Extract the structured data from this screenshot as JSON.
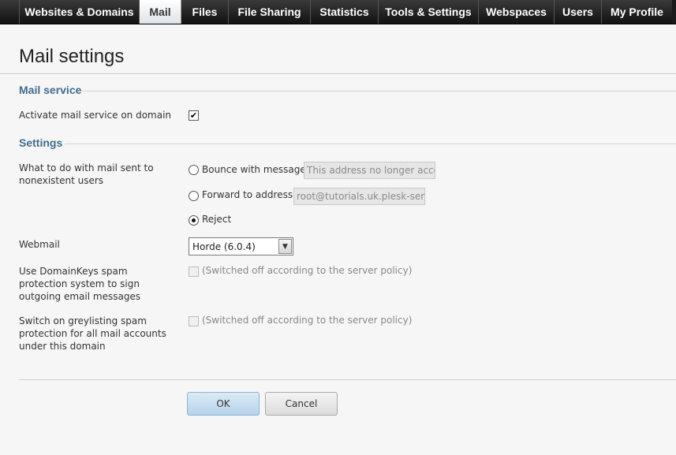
{
  "nav": {
    "tabs": [
      {
        "label": "Websites & Domains"
      },
      {
        "label": "Mail"
      },
      {
        "label": "Files"
      },
      {
        "label": "File Sharing"
      },
      {
        "label": "Statistics"
      },
      {
        "label": "Tools & Settings"
      },
      {
        "label": "Webspaces"
      },
      {
        "label": "Users"
      },
      {
        "label": "My Profile"
      }
    ],
    "active_tab": "Mail"
  },
  "page": {
    "title": "Mail settings"
  },
  "mail_service": {
    "heading": "Mail service",
    "activate_label": "Activate mail service on domain",
    "activate_checked": true
  },
  "settings": {
    "heading": "Settings",
    "nonexistent": {
      "label": "What to do with mail sent to nonexistent users",
      "options": [
        {
          "label": "Bounce with message",
          "value": "This address no longer accepts mail.",
          "selected": false
        },
        {
          "label": "Forward to address",
          "value": "root@tutorials.uk.plesk-server.com",
          "selected": false
        },
        {
          "label": "Reject",
          "selected": true
        }
      ]
    },
    "webmail": {
      "label": "Webmail",
      "selected": "Horde (6.0.4)"
    },
    "domainkeys": {
      "label": "Use DomainKeys spam protection system to sign outgoing email messages",
      "note": "(Switched off according to the server policy)"
    },
    "greylisting": {
      "label": "Switch on greylisting spam protection for all mail accounts under this domain",
      "note": "(Switched off according to the server policy)"
    }
  },
  "buttons": {
    "ok": "OK",
    "cancel": "Cancel"
  },
  "colors": {
    "nav_bg": "#1a1a1a",
    "section_heading": "#406c8c",
    "ok_button": "#b7d3ea"
  }
}
